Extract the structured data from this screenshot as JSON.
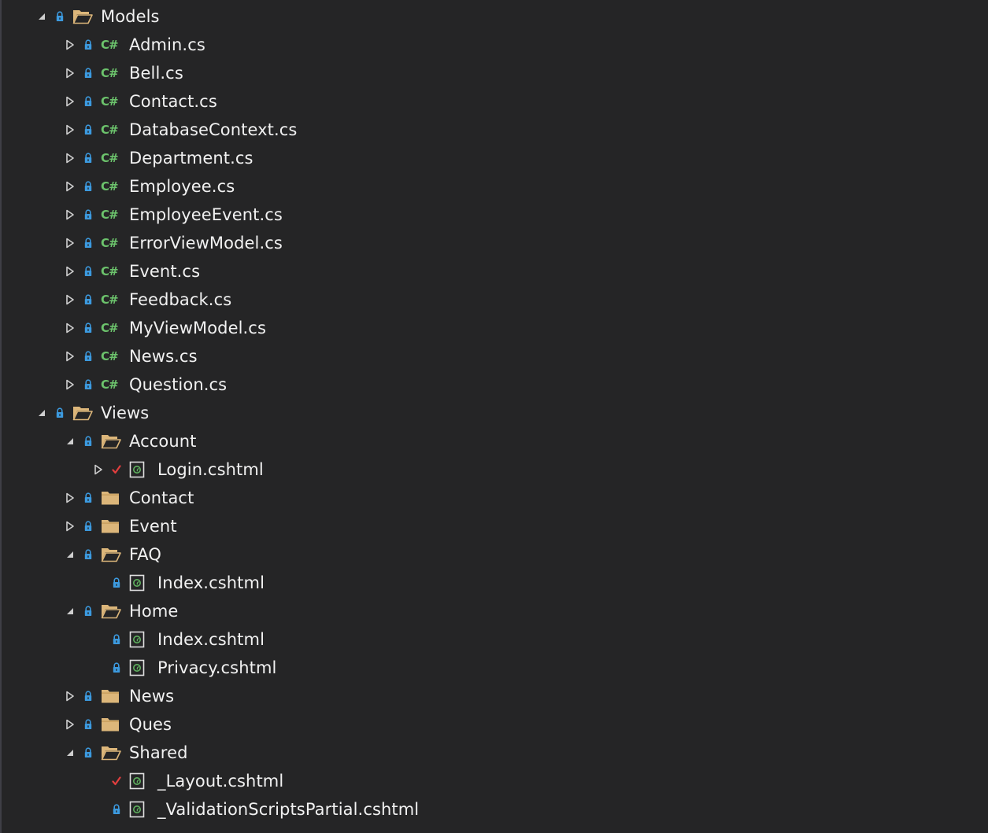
{
  "solution_explorer": {
    "items": [
      {
        "label": "Models",
        "depth": 0,
        "kind": "folder",
        "expanded": true,
        "state": "lock"
      },
      {
        "label": "Admin.cs",
        "depth": 1,
        "kind": "cs",
        "expandable": true,
        "state": "lock"
      },
      {
        "label": "Bell.cs",
        "depth": 1,
        "kind": "cs",
        "expandable": true,
        "state": "lock"
      },
      {
        "label": "Contact.cs",
        "depth": 1,
        "kind": "cs",
        "expandable": true,
        "state": "lock"
      },
      {
        "label": "DatabaseContext.cs",
        "depth": 1,
        "kind": "cs",
        "expandable": true,
        "state": "lock"
      },
      {
        "label": "Department.cs",
        "depth": 1,
        "kind": "cs",
        "expandable": true,
        "state": "lock"
      },
      {
        "label": "Employee.cs",
        "depth": 1,
        "kind": "cs",
        "expandable": true,
        "state": "lock"
      },
      {
        "label": "EmployeeEvent.cs",
        "depth": 1,
        "kind": "cs",
        "expandable": true,
        "state": "lock"
      },
      {
        "label": "ErrorViewModel.cs",
        "depth": 1,
        "kind": "cs",
        "expandable": true,
        "state": "lock"
      },
      {
        "label": "Event.cs",
        "depth": 1,
        "kind": "cs",
        "expandable": true,
        "state": "lock"
      },
      {
        "label": "Feedback.cs",
        "depth": 1,
        "kind": "cs",
        "expandable": true,
        "state": "lock"
      },
      {
        "label": "MyViewModel.cs",
        "depth": 1,
        "kind": "cs",
        "expandable": true,
        "state": "lock"
      },
      {
        "label": "News.cs",
        "depth": 1,
        "kind": "cs",
        "expandable": true,
        "state": "lock"
      },
      {
        "label": "Question.cs",
        "depth": 1,
        "kind": "cs",
        "expandable": true,
        "state": "lock"
      },
      {
        "label": "Views",
        "depth": 0,
        "kind": "folder",
        "expanded": true,
        "state": "lock"
      },
      {
        "label": "Account",
        "depth": 1,
        "kind": "folder",
        "expanded": true,
        "state": "lock"
      },
      {
        "label": "Login.cshtml",
        "depth": 2,
        "kind": "cshtml",
        "expandable": true,
        "state": "check"
      },
      {
        "label": "Contact",
        "depth": 1,
        "kind": "folder",
        "expanded": false,
        "state": "lock"
      },
      {
        "label": "Event",
        "depth": 1,
        "kind": "folder",
        "expanded": false,
        "state": "lock"
      },
      {
        "label": "FAQ",
        "depth": 1,
        "kind": "folder",
        "expanded": true,
        "state": "lock"
      },
      {
        "label": "Index.cshtml",
        "depth": 2,
        "kind": "cshtml",
        "expandable": false,
        "state": "lock"
      },
      {
        "label": "Home",
        "depth": 1,
        "kind": "folder",
        "expanded": true,
        "state": "lock"
      },
      {
        "label": "Index.cshtml",
        "depth": 2,
        "kind": "cshtml",
        "expandable": false,
        "state": "lock"
      },
      {
        "label": "Privacy.cshtml",
        "depth": 2,
        "kind": "cshtml",
        "expandable": false,
        "state": "lock"
      },
      {
        "label": "News",
        "depth": 1,
        "kind": "folder",
        "expanded": false,
        "state": "lock"
      },
      {
        "label": "Ques",
        "depth": 1,
        "kind": "folder",
        "expanded": false,
        "state": "lock"
      },
      {
        "label": "Shared",
        "depth": 1,
        "kind": "folder",
        "expanded": true,
        "state": "lock"
      },
      {
        "label": "_Layout.cshtml",
        "depth": 2,
        "kind": "cshtml",
        "expandable": false,
        "state": "check"
      },
      {
        "label": "_ValidationScriptsPartial.cshtml",
        "depth": 2,
        "kind": "cshtml",
        "expandable": false,
        "state": "lock"
      }
    ]
  },
  "icons": {
    "csharp_glyph": "C#",
    "expanded": "chevron-expanded-icon",
    "collapsed": "chevron-collapsed-icon",
    "lock": "lock-icon",
    "checked_out": "checkmark-icon",
    "folder_open": "folder-open-icon",
    "folder_closed": "folder-closed-icon",
    "csharp_file": "csharp-file-icon",
    "razor_file": "razor-file-icon"
  },
  "colors": {
    "background": "#252526",
    "text": "#f1f1f1",
    "lock": "#3c9adf",
    "check": "#e03e3e",
    "folder": "#dcb67a",
    "csharp": "#6cc36c",
    "razor_green": "#5fb25f",
    "chevron": "#cfcfcf"
  }
}
